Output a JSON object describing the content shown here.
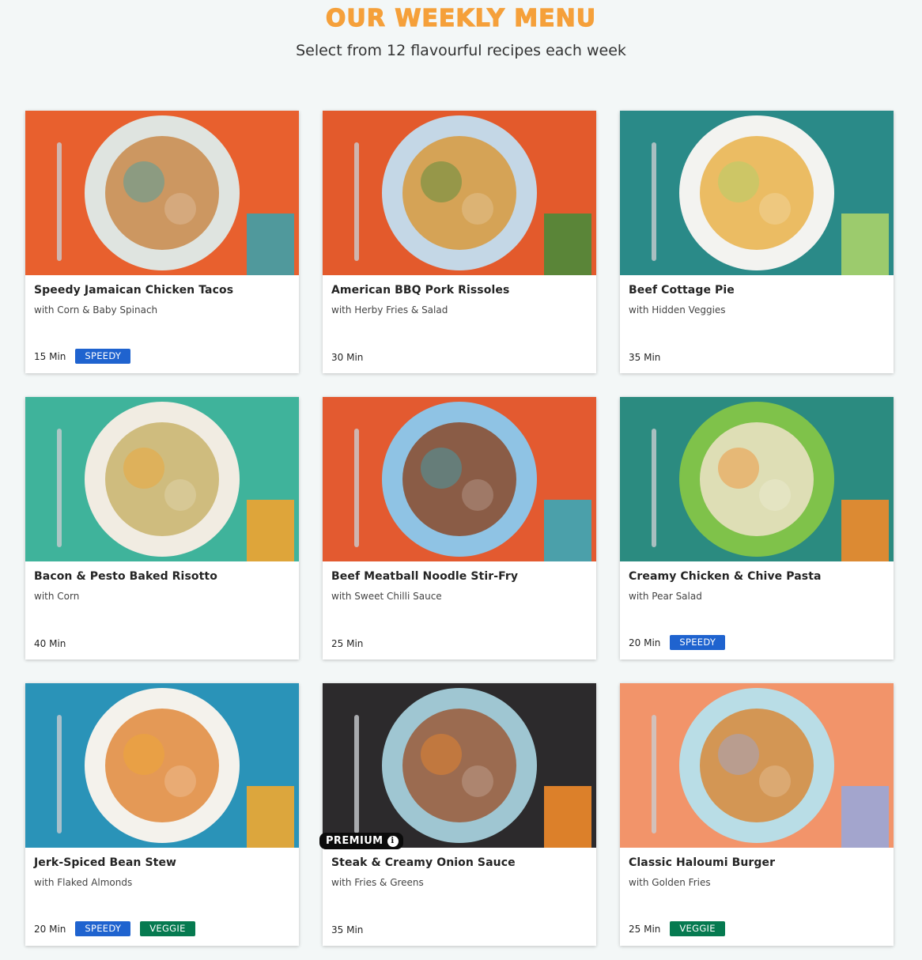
{
  "header": {
    "title": "OUR WEEKLY MENU",
    "subtitle": "Select from 12 flavourful recipes each week"
  },
  "colors": {
    "title": "#f5a03a",
    "speedy_tag": "#1f63cf",
    "veggie_tag": "#067a50",
    "premium_badge": "#0b0b0b"
  },
  "recipes": [
    {
      "name": "Speedy Jamaican Chicken Tacos",
      "subtitle": "with Corn & Baby Spinach",
      "time": "15 Min",
      "tags": [
        "SPEEDY"
      ],
      "premium": false,
      "image": {
        "bg": "#e8602e",
        "plate": "#dfe4e0",
        "food": "#c98a4a",
        "accent": "#3fa0a8"
      }
    },
    {
      "name": "American BBQ Pork Rissoles",
      "subtitle": "with Herby Fries & Salad",
      "time": "30 Min",
      "tags": [],
      "premium": false,
      "image": {
        "bg": "#e35a2c",
        "plate": "#c4d7e6",
        "food": "#d89a3c",
        "accent": "#4a8a3a"
      }
    },
    {
      "name": "Beef Cottage Pie",
      "subtitle": "with Hidden Veggies",
      "time": "35 Min",
      "tags": [],
      "premium": false,
      "image": {
        "bg": "#2a8a88",
        "plate": "#f3f3f0",
        "food": "#e9b24a",
        "accent": "#a9d26a"
      }
    },
    {
      "name": "Bacon & Pesto Baked Risotto",
      "subtitle": "with Corn",
      "time": "40 Min",
      "tags": [],
      "premium": false,
      "image": {
        "bg": "#3fb39b",
        "plate": "#f1ece2",
        "food": "#c9b46c",
        "accent": "#f0a330"
      }
    },
    {
      "name": "Beef Meatball Noodle Stir-Fry",
      "subtitle": "with Sweet Chilli Sauce",
      "time": "25 Min",
      "tags": [],
      "premium": false,
      "image": {
        "bg": "#e35a30",
        "plate": "#8fc3e4",
        "food": "#8a4a2a",
        "accent": "#3aa7b8"
      }
    },
    {
      "name": "Creamy Chicken & Chive Pasta",
      "subtitle": "with Pear Salad",
      "time": "20 Min",
      "tags": [
        "SPEEDY"
      ],
      "premium": false,
      "image": {
        "bg": "#2b8b80",
        "plate": "#7fc24a",
        "food": "#efe3c8",
        "accent": "#f08a2a"
      }
    },
    {
      "name": "Jerk-Spiced Bean Stew",
      "subtitle": "with Flaked Almonds",
      "time": "20 Min",
      "tags": [
        "SPEEDY",
        "VEGGIE"
      ],
      "premium": false,
      "image": {
        "bg": "#2a93b8",
        "plate": "#f4f2ec",
        "food": "#e08a3c",
        "accent": "#f0a830"
      }
    },
    {
      "name": "Steak & Creamy Onion Sauce",
      "subtitle": "with Fries & Greens",
      "time": "35 Min",
      "tags": [],
      "premium": true,
      "premium_label": "PREMIUM",
      "image": {
        "bg": "#2c2a2c",
        "plate": "#9fc6d2",
        "food": "#9a5a3a",
        "accent": "#ef8a2a"
      }
    },
    {
      "name": "Classic Haloumi Burger",
      "subtitle": "with Golden Fries",
      "time": "25 Min",
      "tags": [
        "VEGGIE"
      ],
      "premium": false,
      "image": {
        "bg": "#f2946a",
        "plate": "#b9dde6",
        "food": "#d78a3a",
        "accent": "#9aa6d8"
      }
    }
  ]
}
